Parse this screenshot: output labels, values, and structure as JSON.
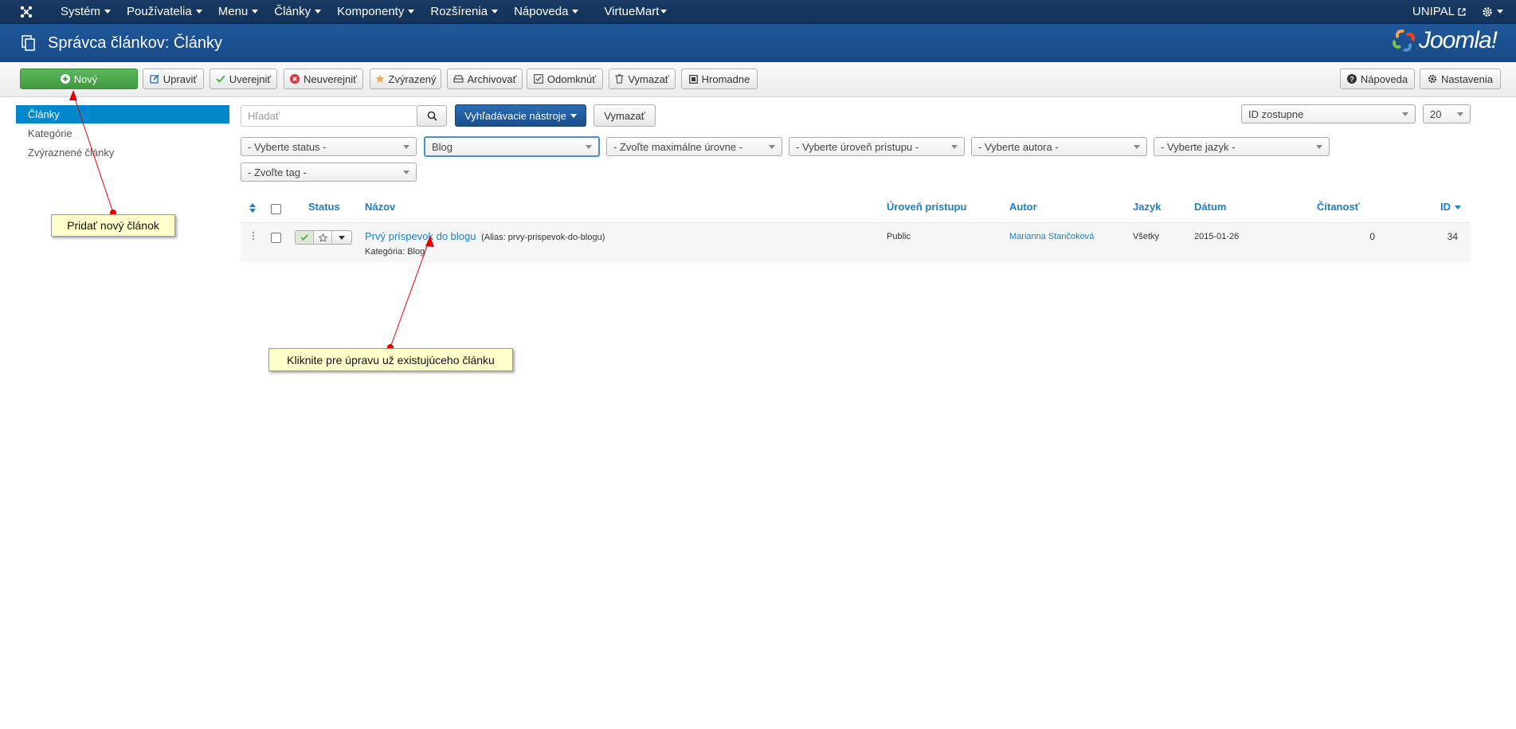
{
  "nav": {
    "items": [
      "Systém",
      "Používatelia",
      "Menu",
      "Články",
      "Komponenty",
      "Rozšírenia",
      "Nápoveda",
      "VirtueMart"
    ],
    "site": "UNIPAL"
  },
  "header": {
    "title": "Správca článkov: Články",
    "brand": "Joomla!"
  },
  "toolbar": {
    "new": "Nový",
    "edit": "Upraviť",
    "publish": "Uverejniť",
    "unpublish": "Neuverejniť",
    "featured": "Zvýrazený",
    "archive": "Archivovať",
    "checkin": "Odomknúť",
    "trash": "Vymazať",
    "batch": "Hromadne",
    "help": "Nápoveda",
    "options": "Nastavenia"
  },
  "sidebar": {
    "items": [
      "Články",
      "Kategórie",
      "Zvýraznené články"
    ]
  },
  "search": {
    "placeholder": "Hľadať",
    "tools": "Vyhľadávacie nástroje",
    "clear": "Vymazať",
    "ordering": "ID zostupne",
    "limit": "20"
  },
  "filters": {
    "status": "- Vyberte status -",
    "category": "Blog",
    "level": "- Zvoľte maximálne úrovne -",
    "access": "- Vyberte úroveň prístupu -",
    "author": "- Vyberte autora -",
    "language": "- Vyberte jazyk -",
    "tag": "- Zvoľte tag -"
  },
  "table": {
    "headers": {
      "status": "Status",
      "title": "Názov",
      "access": "Úroveň prístupu",
      "author": "Autor",
      "language": "Jazyk",
      "date": "Dátum",
      "hits": "Čítanosť",
      "id": "ID"
    },
    "rows": [
      {
        "title": "Prvý príspevok do blogu",
        "alias": "(Alias: prvy-prispevok-do-blogu)",
        "category": "Kategória: Blog",
        "access": "Public",
        "author": "Marianna Stančoková",
        "language": "Všetky",
        "date": "2015-01-26",
        "hits": "0",
        "id": "34"
      }
    ]
  },
  "annotations": {
    "new_article": "Pridať nový článok",
    "edit_article": "Kliknite pre úpravu už existujúceho článku"
  },
  "colors": {
    "accent": "#0088cc",
    "nav": "#13325a",
    "header": "#1e5799",
    "success": "#4cae4c",
    "annotation_arrow": "#e00000"
  }
}
